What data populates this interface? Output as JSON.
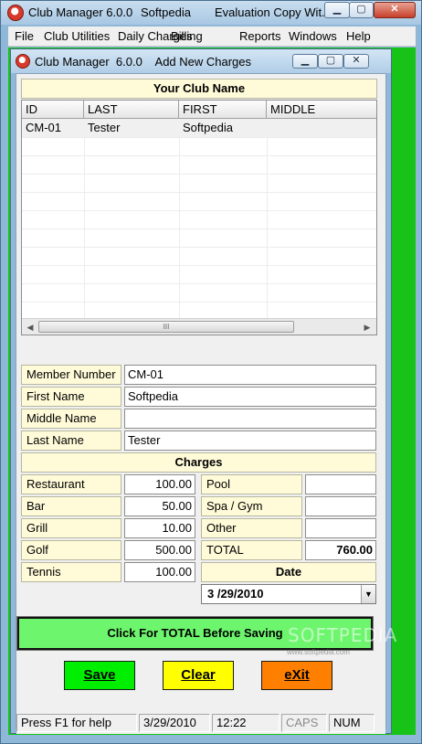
{
  "outer_window": {
    "title_app": "Club Manager  6.0.0",
    "title_vendor": "Softpedia",
    "title_extra": "Evaluation Copy Wit..."
  },
  "menu": [
    "File",
    "Club Utilities",
    "Daily Charges",
    "Billing",
    "Reports",
    "Windows",
    "Help"
  ],
  "child_window": {
    "title": "Club Manager  6.0.0    Add New Charges"
  },
  "club_name": "Your Club Name",
  "grid": {
    "columns": [
      "ID",
      "LAST",
      "FIRST",
      "MIDDLE"
    ],
    "rows": [
      {
        "id": "CM-01",
        "last": "Tester",
        "first": "Softpedia",
        "middle": ""
      }
    ]
  },
  "member": {
    "number_label": "Member Number",
    "number_value": "CM-01",
    "first_label": "First Name",
    "first_value": "Softpedia",
    "middle_label": "Middle Name",
    "middle_value": "",
    "last_label": "Last Name",
    "last_value": "Tester"
  },
  "charges": {
    "title": "Charges",
    "restaurant_label": "Restaurant",
    "restaurant_value": "100.00",
    "bar_label": "Bar",
    "bar_value": "50.00",
    "grill_label": "Grill",
    "grill_value": "10.00",
    "golf_label": "Golf",
    "golf_value": "500.00",
    "tennis_label": "Tennis",
    "tennis_value": "100.00",
    "pool_label": "Pool",
    "pool_value": "",
    "spa_label": "Spa / Gym",
    "spa_value": "",
    "other_label": "Other",
    "other_value": "",
    "total_label": "TOTAL",
    "total_value": "760.00"
  },
  "date": {
    "label": "Date",
    "value": "3 /29/2010"
  },
  "buttons": {
    "total": "Click For TOTAL Before Saving",
    "save": "Save",
    "clear": "Clear",
    "exit": "eXit"
  },
  "status": {
    "help": "Press F1 for help",
    "date": "3/29/2010",
    "time": "12:22",
    "caps": "CAPS",
    "num": "NUM"
  },
  "watermark": {
    "text": "SOFTPEDIA",
    "url": "www.softpedia.com"
  },
  "colors": {
    "mdi_background": "#17c317",
    "label_background": "#fffbd9",
    "total_button": "#6ef56e",
    "save_button": "#00ee00",
    "clear_button": "#ffff00",
    "exit_button": "#ff8000"
  }
}
